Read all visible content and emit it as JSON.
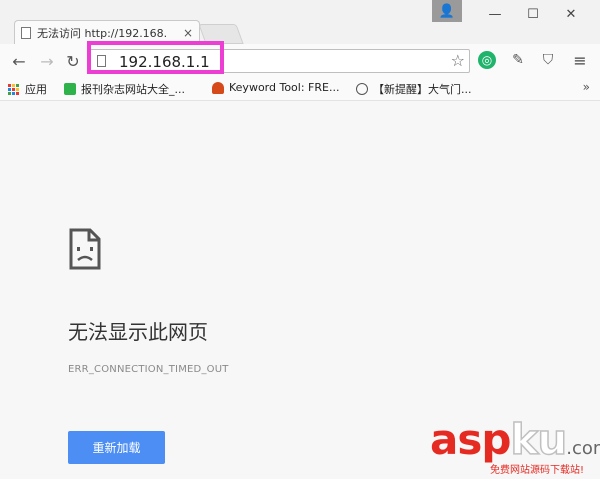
{
  "window": {
    "tab_title": "无法访问 http://192.168.",
    "tab_close": "×",
    "controls": {
      "user": "👤",
      "minimize": "—",
      "maximize": "☐",
      "close": "✕"
    }
  },
  "toolbar": {
    "back": "←",
    "forward": "→",
    "reload": "↻",
    "url": "192.168.1.1",
    "star": "☆",
    "menu": "≡",
    "highlight_color": "#ec3ed2"
  },
  "bookmarks": {
    "items": [
      {
        "label": "应用",
        "icon": "apps-icon"
      },
      {
        "label": "报刊杂志网站大全_...",
        "icon": "green-c-icon"
      },
      {
        "label": "Keyword Tool: FRE...",
        "icon": "keyword-tool-icon"
      },
      {
        "label": "【新提醒】大气门...",
        "icon": "wordpress-icon"
      }
    ],
    "more": "»"
  },
  "error_page": {
    "icon": "sad-page-icon",
    "heading": "无法显示此网页",
    "error_code": "ERR_CONNECTION_TIMED_OUT",
    "reload_button": "重新加载",
    "button_color": "#4c8ef3"
  },
  "watermark": {
    "asp": "asp",
    "ku": "ku",
    "dotcom": ".com",
    "sub": "免费网站源码下载站!"
  }
}
